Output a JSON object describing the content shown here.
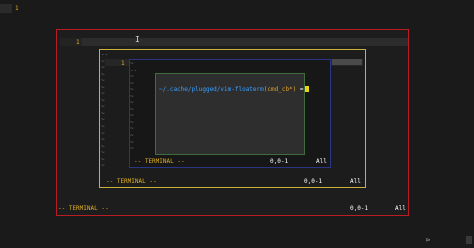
{
  "top_editor": {
    "line_number": "1"
  },
  "outer_float": {
    "line_number": "1",
    "cursor_glyph": "I",
    "status": {
      "mode": "-- TERMINAL --",
      "position": "0,0-1",
      "scroll": "All"
    }
  },
  "middle_float": {
    "line_number": "1",
    "tilde_lines": [
      "--",
      "~",
      "~",
      "~",
      "~",
      "~",
      "~",
      "~",
      "~",
      "~",
      "~",
      "~",
      "~",
      "~",
      "~",
      "~",
      "~",
      "~"
    ],
    "status": {
      "mode": "-- TERMINAL --",
      "position": "0,0-1",
      "scroll": "All"
    }
  },
  "inner_float": {
    "tilde_lines": [
      "~",
      "--",
      "~",
      "~",
      "~",
      "~",
      "~",
      "~",
      "~",
      "~",
      "~",
      "~",
      "~",
      "~"
    ],
    "status": {
      "mode": "-- TERMINAL --",
      "position": "0,0-1",
      "scroll": "All"
    }
  },
  "cmd_float": {
    "path": "~/.cache/plugged/vim-floaterm",
    "function": "(cmd_cb*)",
    "suffix": " ="
  },
  "corner_glyph_right": "⊳",
  "colors": {
    "outer_border": "#b81d24",
    "middle_border": "#c9b13a",
    "inner_border": "#2a3585",
    "cmd_border": "#3f6b3f",
    "accent_yellow": "#e0b020",
    "path_blue": "#3aa0ff"
  }
}
